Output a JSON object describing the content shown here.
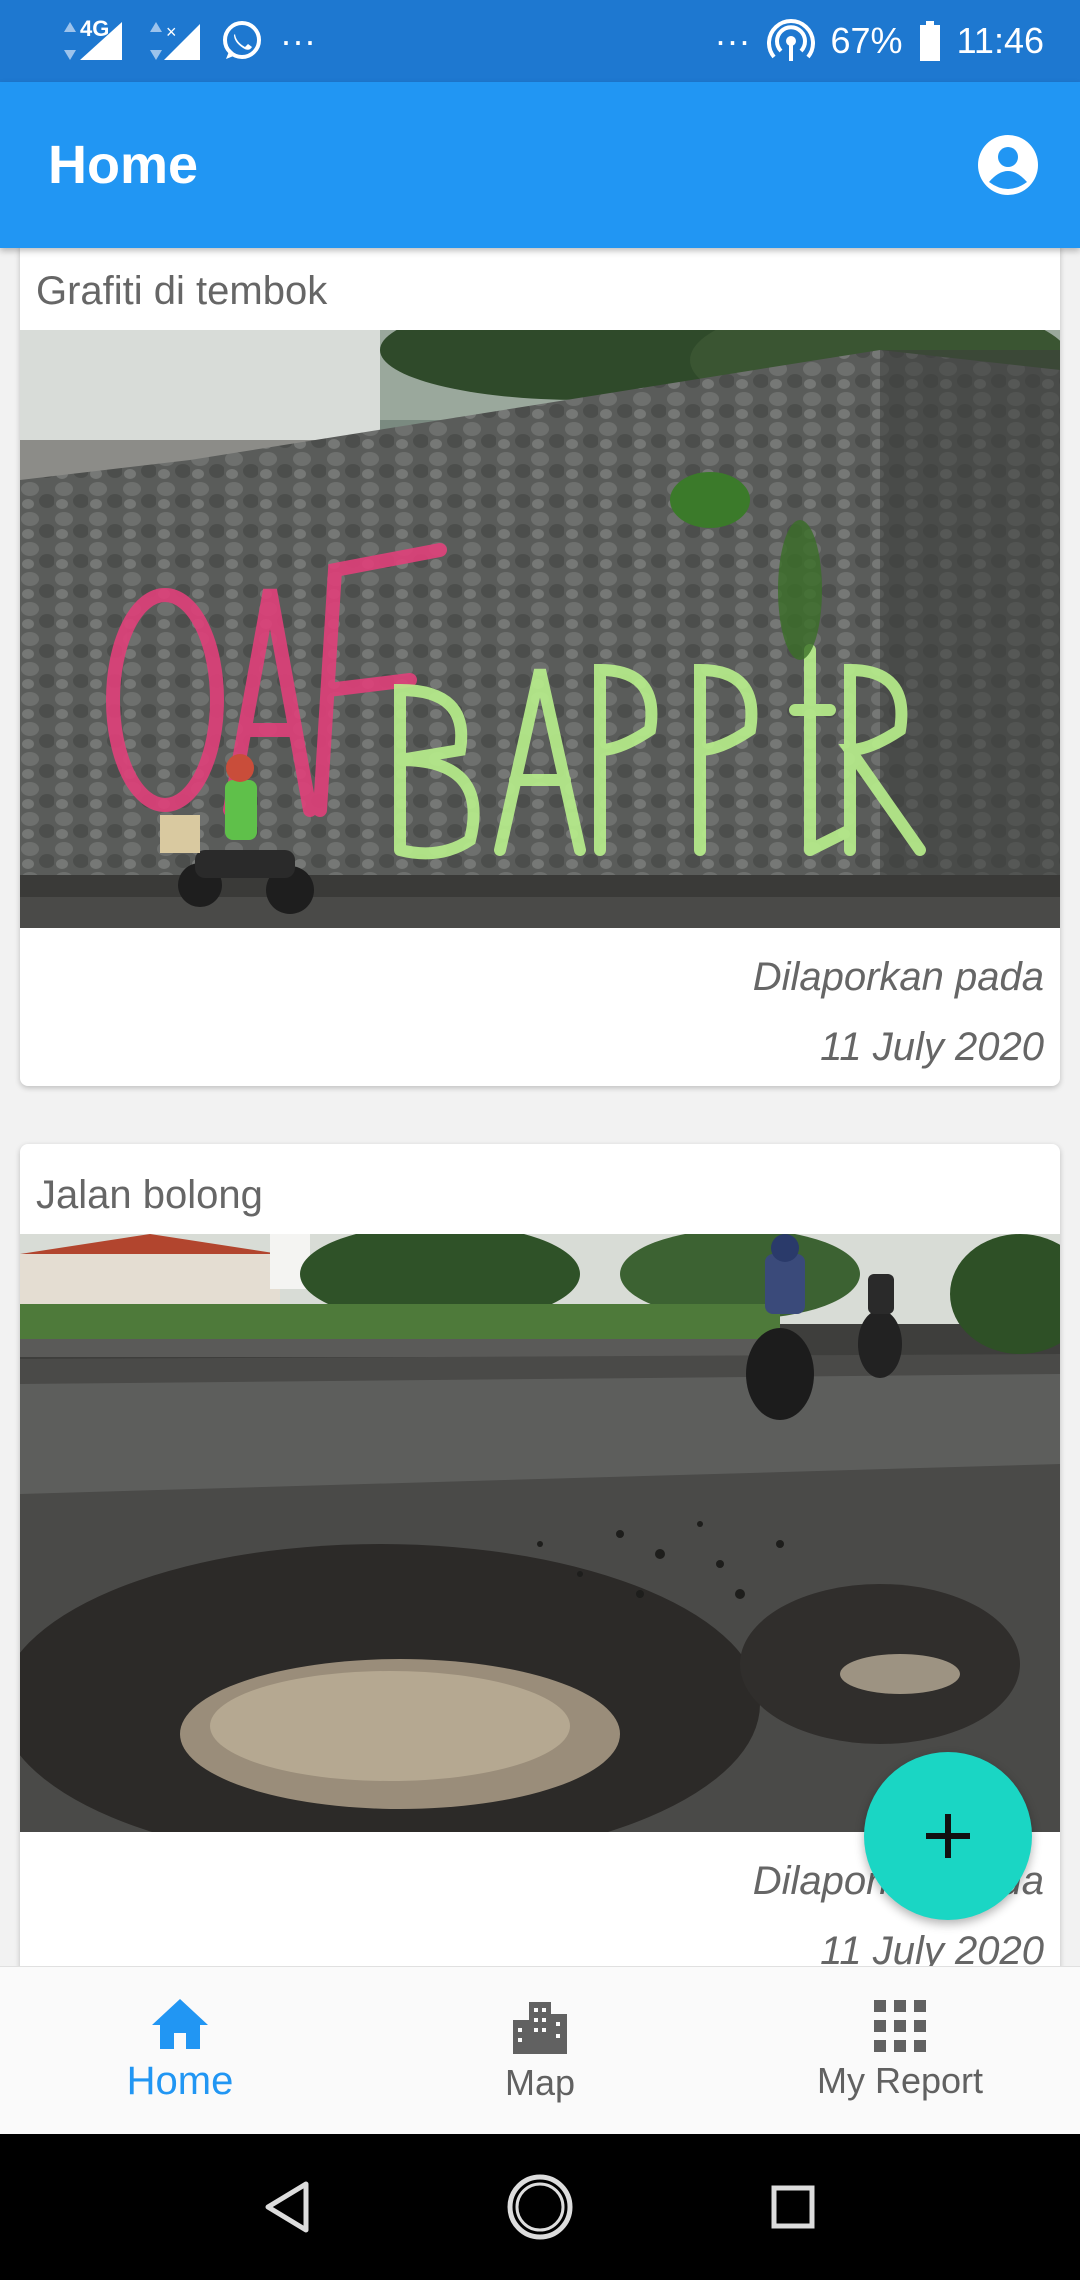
{
  "status_bar": {
    "network": "4G",
    "overflow_left": "···",
    "overflow_right": "···",
    "battery": "67%",
    "time": "11:46",
    "icons": [
      "signal-icon",
      "no-signal-icon",
      "whatsapp-icon",
      "hotspot-icon",
      "battery-icon"
    ]
  },
  "app_bar": {
    "title": "Home",
    "account_icon": "account-circle-icon"
  },
  "reports": [
    {
      "title": "Grafiti di tembok",
      "reported_label": "Dilaporkan pada",
      "date": "11 July 2020",
      "image": "graffiti-wall-photo"
    },
    {
      "title": "Jalan bolong",
      "reported_label": "Dilaporkan pada",
      "date": "11 July 2020",
      "image": "pothole-road-photo"
    }
  ],
  "fab": {
    "icon": "plus-icon",
    "color": "#1ad6c4"
  },
  "bottom_nav": {
    "items": [
      {
        "label": "Home",
        "icon": "home-icon",
        "active": true
      },
      {
        "label": "Map",
        "icon": "city-icon",
        "active": false
      },
      {
        "label": "My Report",
        "icon": "grid-icon",
        "active": false
      }
    ]
  },
  "colors": {
    "primary": "#2196f3",
    "status_bar": "#1e78d0",
    "accent": "#1ad6c4"
  }
}
